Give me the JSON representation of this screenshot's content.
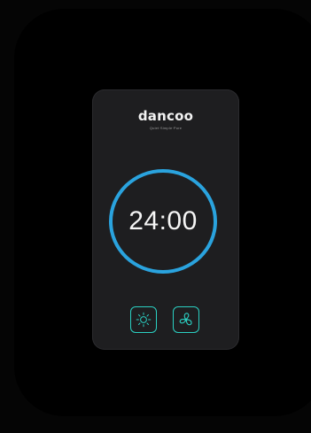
{
  "device": {
    "brand": "dancoo",
    "tagline": "Quiet·Simple·Pure"
  },
  "timer": {
    "value": "24:00"
  },
  "controls": {
    "light_icon": "sun-icon",
    "fan_icon": "fan-icon"
  },
  "colors": {
    "ring": "#2aa3de",
    "buttons": "#2bd0c2",
    "device_body": "#1e1e20"
  }
}
